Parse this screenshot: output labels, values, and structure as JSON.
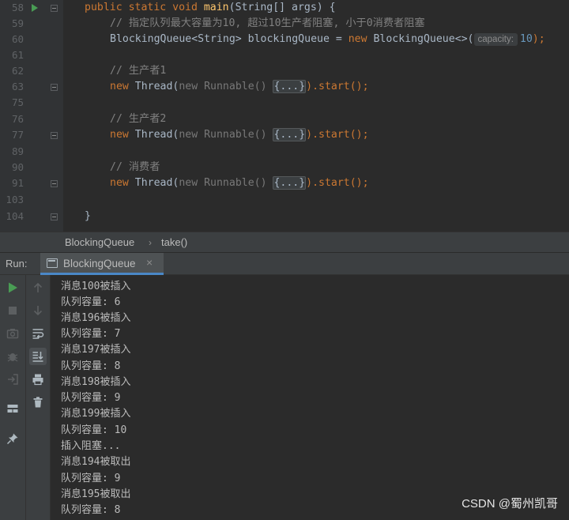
{
  "editor": {
    "line_numbers": [
      "58",
      "59",
      "60",
      "61",
      "62",
      "63",
      "75",
      "76",
      "77",
      "89",
      "90",
      "91",
      "103",
      "104"
    ],
    "code": {
      "l58": {
        "kw1": "public static void ",
        "fn": "main",
        "rest": "(String[] args) {"
      },
      "l59": {
        "comment": "// 指定队列最大容量为10, 超过10生产者阻塞, 小于0消费者阻塞"
      },
      "l60": {
        "a": "BlockingQueue<String> blockingQueue = ",
        "kw": "new ",
        "b": "BlockingQueue<>(",
        "hint": "capacity:",
        "num": "10",
        "c": ");"
      },
      "l62": {
        "comment": "// 生产者1"
      },
      "l63": {
        "kw": "new ",
        "cls": "Thread",
        "p": "(",
        "anon": "new Runnable() ",
        "fold": "{...}",
        "end": ").start();"
      },
      "l76": {
        "comment": "// 生产者2"
      },
      "l77": {
        "kw": "new ",
        "cls": "Thread",
        "p": "(",
        "anon": "new Runnable() ",
        "fold": "{...}",
        "end": ").start();"
      },
      "l90": {
        "comment": "// 消费者"
      },
      "l91": {
        "kw": "new ",
        "cls": "Thread",
        "p": "(",
        "anon": "new Runnable() ",
        "fold": "{...}",
        "end": ").start();"
      },
      "l104": {
        "brace": "}"
      }
    }
  },
  "breadcrumb": {
    "class_name": "BlockingQueue",
    "separator": "›",
    "method": "take()"
  },
  "run_panel": {
    "label": "Run:",
    "tab_label": "BlockingQueue",
    "tab_close": "×",
    "icons": [
      "run-icon",
      "stop-icon",
      "camera-icon",
      "bug-icon",
      "exit-icon",
      "layout-icon",
      "pin-icon",
      "up-arrow-icon",
      "down-arrow-icon",
      "soft-wrap-icon",
      "scroll-to-end-icon",
      "print-icon",
      "trash-icon"
    ]
  },
  "console": {
    "lines": [
      "消息100被插入",
      "队列容量: 6",
      "消息196被插入",
      "队列容量: 7",
      "消息197被插入",
      "队列容量: 8",
      "消息198被插入",
      "队列容量: 9",
      "消息199被插入",
      "队列容量: 10",
      "插入阻塞...",
      "消息194被取出",
      "队列容量: 9",
      "消息195被取出",
      "队列容量: 8"
    ]
  },
  "watermark": "CSDN @蜀州凯哥",
  "colors": {
    "keyword": "#cc7832",
    "function": "#ffc66d",
    "comment": "#808080",
    "number": "#6897bb",
    "run_green": "#499c54",
    "tab_underline": "#4a88c7"
  }
}
